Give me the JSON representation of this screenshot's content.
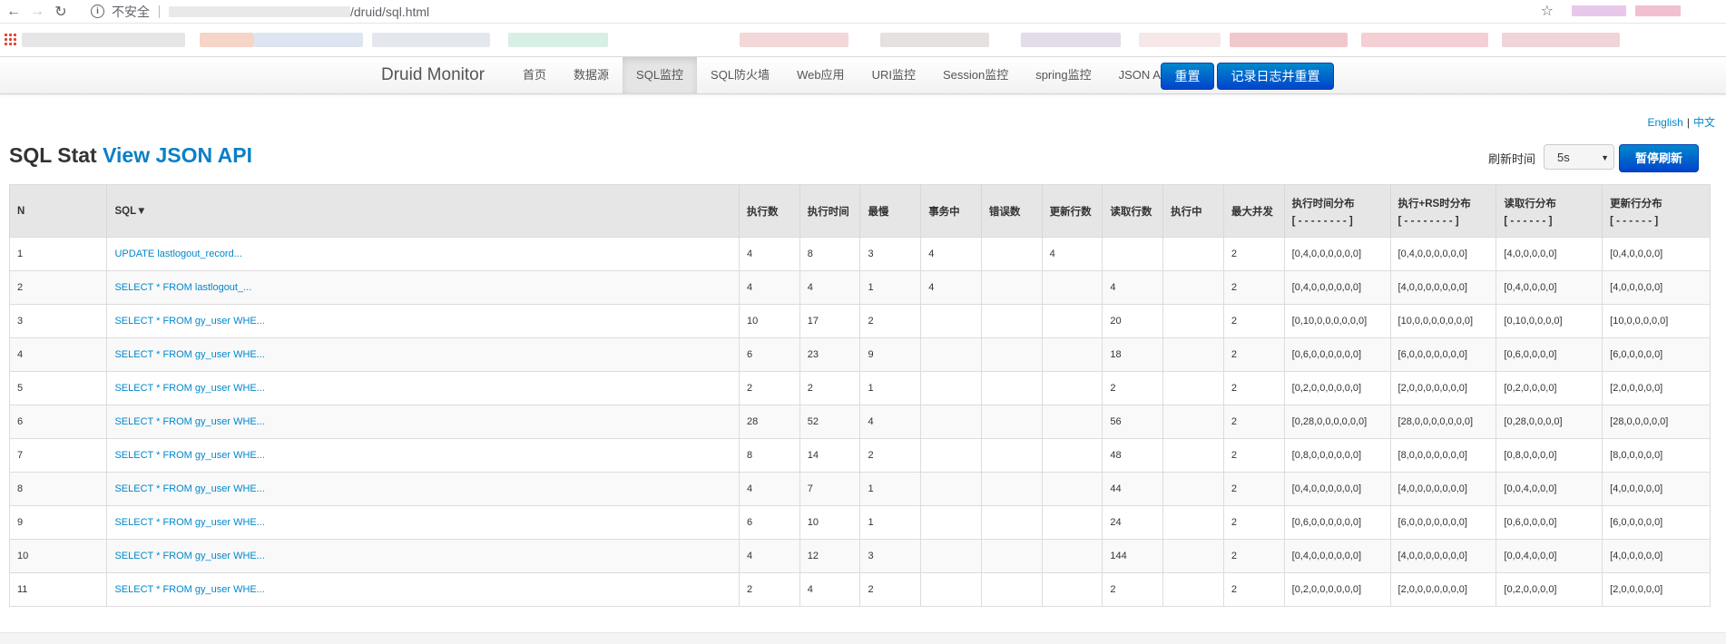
{
  "browser": {
    "insecure_label": "不安全",
    "url_path": "/druid/sql.html"
  },
  "nav": {
    "brand": "Druid Monitor",
    "items": [
      "首页",
      "数据源",
      "SQL监控",
      "SQL防火墙",
      "Web应用",
      "URI监控",
      "Session监控",
      "spring监控",
      "JSON API"
    ],
    "active": "SQL监控",
    "reset_label": "重置",
    "log_reset_label": "记录日志并重置"
  },
  "lang": {
    "english": "English",
    "chinese": "中文"
  },
  "title": {
    "prefix": "SQL Stat",
    "api_link": "View JSON API"
  },
  "refresh": {
    "label": "刷新时间",
    "value": "5s",
    "pause_label": "暂停刷新"
  },
  "table": {
    "headers": [
      {
        "label": "N"
      },
      {
        "label": "SQL▼"
      },
      {
        "label": "执行数"
      },
      {
        "label": "执行时间"
      },
      {
        "label": "最慢"
      },
      {
        "label": "事务中"
      },
      {
        "label": "错误数"
      },
      {
        "label": "更新行数"
      },
      {
        "label": "读取行数"
      },
      {
        "label": "执行中"
      },
      {
        "label": "最大并发"
      },
      {
        "label": "执行时间分布",
        "sub": "[ - - - - - - - - ]"
      },
      {
        "label": "执行+RS时分布",
        "sub": "[ - - - - - - - - ]"
      },
      {
        "label": "读取行分布",
        "sub": "[ - - - - - - ]"
      },
      {
        "label": "更新行分布",
        "sub": "[ - - - - - - ]"
      }
    ],
    "rows": [
      [
        "1",
        "UPDATE lastlogout_record...",
        "4",
        "8",
        "3",
        "4",
        "",
        "4",
        "",
        "",
        "2",
        "[0,4,0,0,0,0,0,0]",
        "[0,4,0,0,0,0,0,0]",
        "[4,0,0,0,0,0]",
        "[0,4,0,0,0,0]"
      ],
      [
        "2",
        "SELECT * FROM lastlogout_...",
        "4",
        "4",
        "1",
        "4",
        "",
        "",
        "4",
        "",
        "2",
        "[0,4,0,0,0,0,0,0]",
        "[4,0,0,0,0,0,0,0]",
        "[0,4,0,0,0,0]",
        "[4,0,0,0,0,0]"
      ],
      [
        "3",
        "SELECT * FROM gy_user WHE...",
        "10",
        "17",
        "2",
        "",
        "",
        "",
        "20",
        "",
        "2",
        "[0,10,0,0,0,0,0,0]",
        "[10,0,0,0,0,0,0,0]",
        "[0,10,0,0,0,0]",
        "[10,0,0,0,0,0]"
      ],
      [
        "4",
        "SELECT * FROM gy_user WHE...",
        "6",
        "23",
        "9",
        "",
        "",
        "",
        "18",
        "",
        "2",
        "[0,6,0,0,0,0,0,0]",
        "[6,0,0,0,0,0,0,0]",
        "[0,6,0,0,0,0]",
        "[6,0,0,0,0,0]"
      ],
      [
        "5",
        "SELECT * FROM gy_user WHE...",
        "2",
        "2",
        "1",
        "",
        "",
        "",
        "2",
        "",
        "2",
        "[0,2,0,0,0,0,0,0]",
        "[2,0,0,0,0,0,0,0]",
        "[0,2,0,0,0,0]",
        "[2,0,0,0,0,0]"
      ],
      [
        "6",
        "SELECT * FROM gy_user WHE...",
        "28",
        "52",
        "4",
        "",
        "",
        "",
        "56",
        "",
        "2",
        "[0,28,0,0,0,0,0,0]",
        "[28,0,0,0,0,0,0,0]",
        "[0,28,0,0,0,0]",
        "[28,0,0,0,0,0]"
      ],
      [
        "7",
        "SELECT * FROM gy_user WHE...",
        "8",
        "14",
        "2",
        "",
        "",
        "",
        "48",
        "",
        "2",
        "[0,8,0,0,0,0,0,0]",
        "[8,0,0,0,0,0,0,0]",
        "[0,8,0,0,0,0]",
        "[8,0,0,0,0,0]"
      ],
      [
        "8",
        "SELECT * FROM gy_user WHE...",
        "4",
        "7",
        "1",
        "",
        "",
        "",
        "44",
        "",
        "2",
        "[0,4,0,0,0,0,0,0]",
        "[4,0,0,0,0,0,0,0]",
        "[0,0,4,0,0,0]",
        "[4,0,0,0,0,0]"
      ],
      [
        "9",
        "SELECT * FROM gy_user WHE...",
        "6",
        "10",
        "1",
        "",
        "",
        "",
        "24",
        "",
        "2",
        "[0,6,0,0,0,0,0,0]",
        "[6,0,0,0,0,0,0,0]",
        "[0,6,0,0,0,0]",
        "[6,0,0,0,0,0]"
      ],
      [
        "10",
        "SELECT * FROM gy_user WHE...",
        "4",
        "12",
        "3",
        "",
        "",
        "",
        "144",
        "",
        "2",
        "[0,4,0,0,0,0,0,0]",
        "[4,0,0,0,0,0,0,0]",
        "[0,0,4,0,0,0]",
        "[4,0,0,0,0,0]"
      ],
      [
        "11",
        "SELECT * FROM gy_user WHE...",
        "2",
        "4",
        "2",
        "",
        "",
        "",
        "2",
        "",
        "2",
        "[0,2,0,0,0,0,0,0]",
        "[2,0,0,0,0,0,0,0]",
        "[0,2,0,0,0,0]",
        "[2,0,0,0,0,0]"
      ]
    ]
  }
}
